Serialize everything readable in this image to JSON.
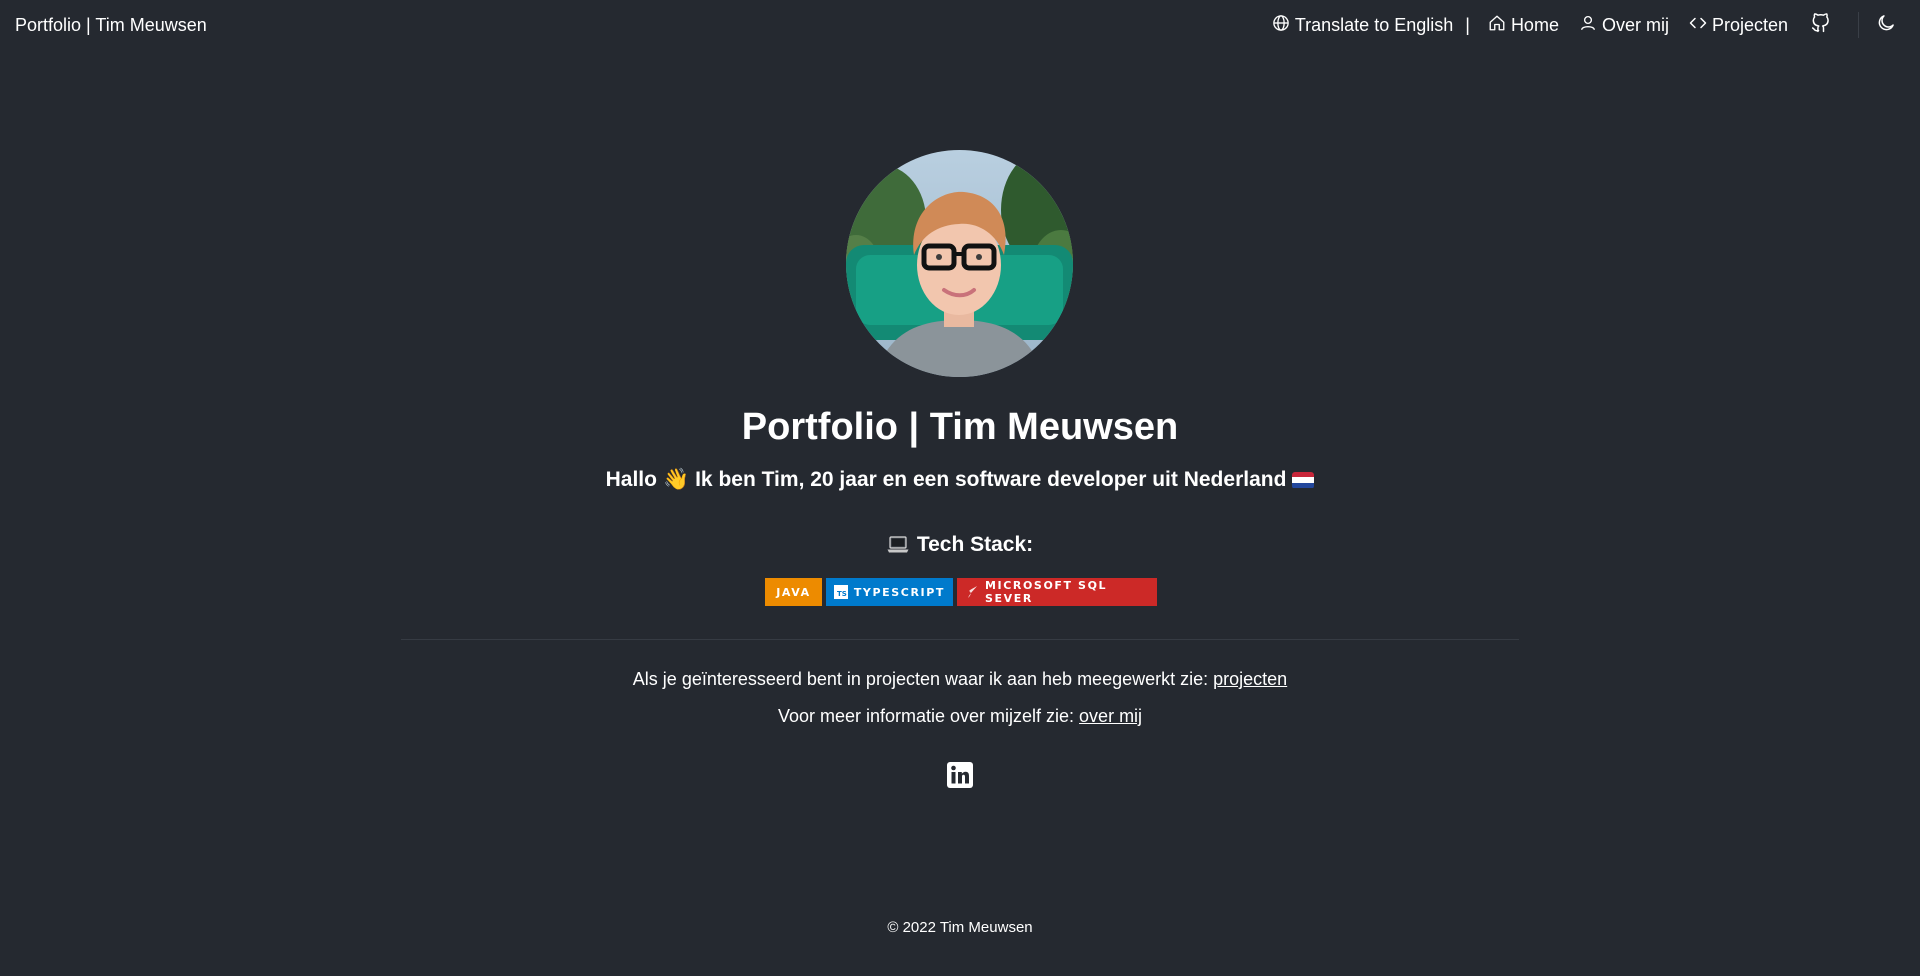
{
  "navbar": {
    "brand": "Portfolio | Tim Meuwsen",
    "translate_label": "Translate to English",
    "separator": "|",
    "home_label": "Home",
    "about_label": "Over mij",
    "projects_label": "Projecten",
    "github_icon": "github-icon",
    "theme_icon": "moon-icon"
  },
  "hero": {
    "avatar_alt": "profile-photo",
    "title": "Portfolio | Tim Meuwsen",
    "intro_text": "Hallo",
    "wave_emoji": "👋",
    "intro_rest": "Ik ben Tim, 20 jaar en een software developer uit Nederland",
    "flag": "netherlands-flag"
  },
  "tech_stack": {
    "emoji": "laptop-icon",
    "title": "Tech Stack:",
    "badges": [
      {
        "label": "JAVA",
        "color": "#ed8b00"
      },
      {
        "label": "TYPESCRIPT",
        "color": "#007acc",
        "logo_text": "TS"
      },
      {
        "label": "MICROSOFT SQL SEVER",
        "color": "#cc2927"
      }
    ]
  },
  "info": {
    "line1_text": "Als je geïnteresseerd bent in projecten waar ik aan heb meegewerkt zie: ",
    "line1_link": "projecten",
    "line2_text": "Voor meer informatie over mijzelf zie: ",
    "line2_link": "over mij"
  },
  "social": {
    "linkedin_icon": "linkedin-icon"
  },
  "footer": {
    "copyright": "© 2022 Tim Meuwsen"
  },
  "colors": {
    "background": "#252930",
    "text": "#ffffff"
  }
}
